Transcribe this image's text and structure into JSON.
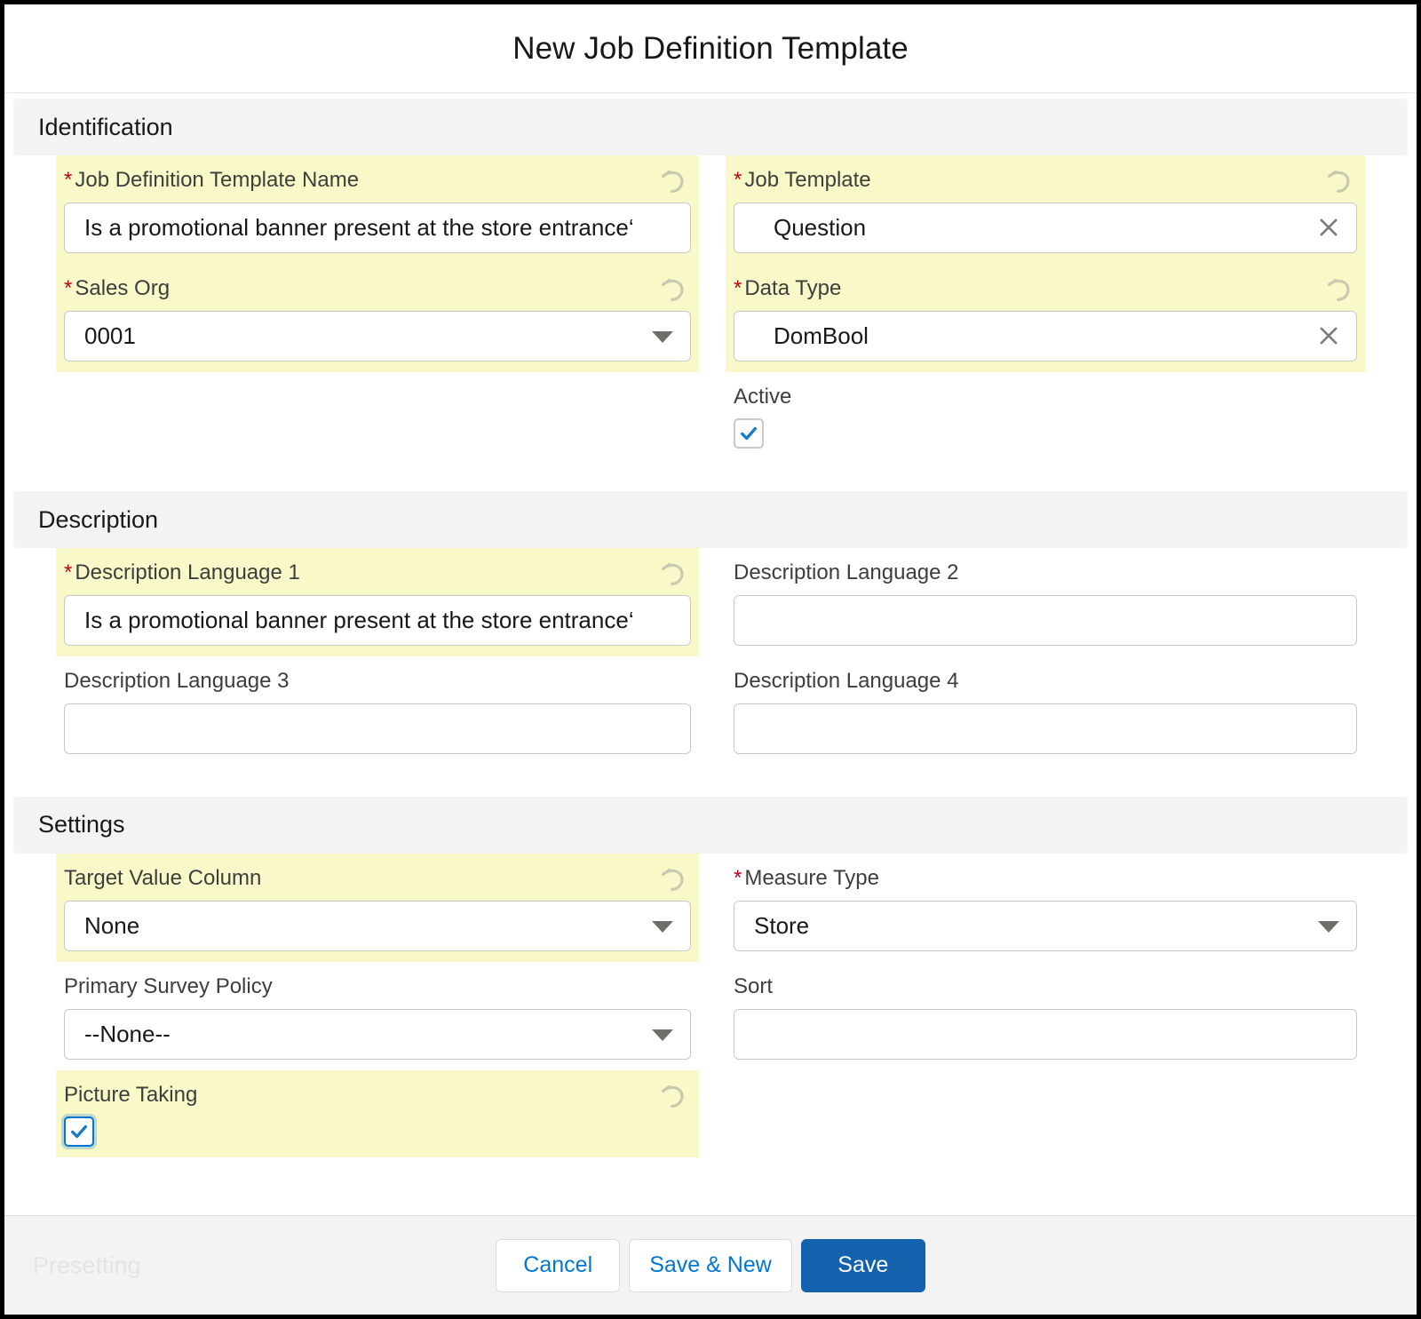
{
  "modal": {
    "title": "New Job Definition Template"
  },
  "sections": {
    "identification": {
      "heading": "Identification",
      "job_definition_template_name": {
        "label": "Job Definition Template Name",
        "value": "Is a promotional banner present at the store entrance‘",
        "required": true,
        "highlighted": true,
        "revert_icon": "undo-icon"
      },
      "sales_org": {
        "label": "Sales Org",
        "value": "0001",
        "required": true,
        "highlighted": true,
        "revert_icon": "undo-icon",
        "control_icon": "chevron-down-icon"
      },
      "job_template": {
        "label": "Job Template",
        "value": "Question",
        "required": true,
        "highlighted": true,
        "revert_icon": "undo-icon",
        "control_icon": "close-icon"
      },
      "data_type": {
        "label": "Data Type",
        "value": "DomBool",
        "required": true,
        "highlighted": true,
        "revert_icon": "undo-icon",
        "control_icon": "close-icon"
      },
      "active": {
        "label": "Active",
        "checked": true,
        "required": false,
        "highlighted": false
      }
    },
    "description": {
      "heading": "Description",
      "description_language_1": {
        "label": "Description Language 1",
        "value": "Is a promotional banner present at the store entrance‘",
        "required": true,
        "highlighted": true,
        "revert_icon": "undo-icon"
      },
      "description_language_2": {
        "label": "Description Language 2",
        "value": "",
        "required": false,
        "highlighted": false
      },
      "description_language_3": {
        "label": "Description Language 3",
        "value": "",
        "required": false,
        "highlighted": false
      },
      "description_language_4": {
        "label": "Description Language 4",
        "value": "",
        "required": false,
        "highlighted": false
      }
    },
    "settings": {
      "heading": "Settings",
      "target_value_column": {
        "label": "Target Value Column",
        "value": "None",
        "required": false,
        "highlighted": true,
        "revert_icon": "undo-icon",
        "control_icon": "chevron-down-icon"
      },
      "measure_type": {
        "label": "Measure Type",
        "value": "Store",
        "required": true,
        "highlighted": false,
        "control_icon": "chevron-down-icon"
      },
      "primary_survey_policy": {
        "label": "Primary Survey Policy",
        "value": "--None--",
        "required": false,
        "highlighted": false,
        "control_icon": "chevron-down-icon"
      },
      "sort": {
        "label": "Sort",
        "value": "",
        "required": false,
        "highlighted": false
      },
      "picture_taking": {
        "label": "Picture Taking",
        "checked": true,
        "required": false,
        "highlighted": true,
        "revert_icon": "undo-icon"
      }
    }
  },
  "footer": {
    "status_text": "Presetting",
    "cancel_label": "Cancel",
    "save_new_label": "Save & New",
    "save_label": "Save"
  },
  "colors": {
    "highlight": "#f8f8c8",
    "required_marker": "#ba0517",
    "brand_blue": "#1461ad",
    "link_blue": "#0176d3",
    "section_header_bg": "#f3f3f3"
  }
}
